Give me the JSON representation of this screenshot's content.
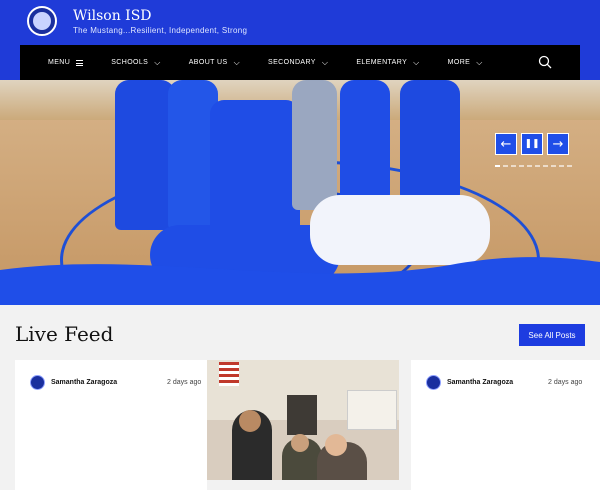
{
  "site": {
    "title": "Wilson ISD",
    "tagline": "The Mustang...Resilient, Independent, Strong"
  },
  "nav": {
    "items": [
      {
        "label": "MENU",
        "icon": "hamburger-icon"
      },
      {
        "label": "SCHOOLS",
        "icon": "chevron-down-icon"
      },
      {
        "label": "ABOUT US",
        "icon": "chevron-down-icon"
      },
      {
        "label": "SECONDARY",
        "icon": "chevron-down-icon"
      },
      {
        "label": "ELEMENTARY",
        "icon": "chevron-down-icon"
      },
      {
        "label": "MORE",
        "icon": "chevron-down-icon"
      }
    ],
    "search_icon": "search-icon"
  },
  "slideshow": {
    "prev_icon": "arrow-left-icon",
    "pause_icon": "pause-icon",
    "next_icon": "arrow-right-icon"
  },
  "feed": {
    "heading": "Live Feed",
    "see_all_label": "See All Posts",
    "posts": [
      {
        "author": "Samantha Zaragoza",
        "time": "2 days ago"
      },
      {
        "author": "Samantha Zaragoza",
        "time": "2 days ago"
      }
    ]
  },
  "colors": {
    "brand_blue": "#1f3bd8",
    "nav_black": "#000000",
    "button_blue": "#1d3ce0"
  }
}
